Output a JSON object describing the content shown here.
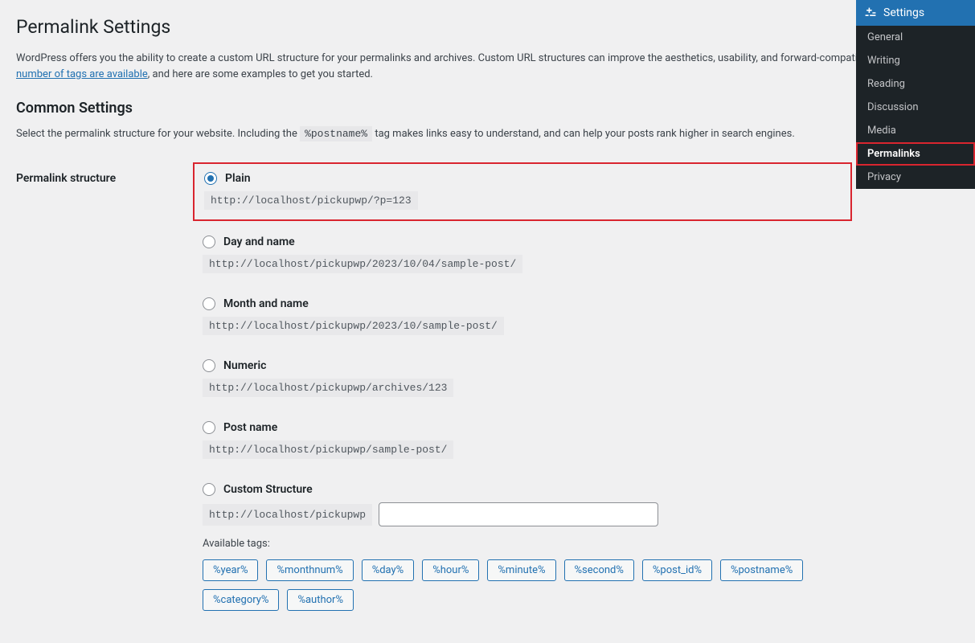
{
  "page": {
    "title": "Permalink Settings",
    "intro1": "WordPress offers you the ability to create a custom URL structure for your permalinks and archives. Custom URL structures can improve the aesthetics, usability, and forward-compatib",
    "intro_link": "number of tags are available",
    "intro_after": ", and here are some examples to get you started.",
    "section_title": "Common Settings",
    "section_desc_before": "Select the permalink structure for your website. Including the ",
    "section_tag": "%postname%",
    "section_desc_after": " tag makes links easy to understand, and can help your posts rank higher in search engines.",
    "structure_label": "Permalink structure"
  },
  "options": [
    {
      "label": "Plain",
      "url": "http://localhost/pickupwp/?p=123",
      "checked": true,
      "highlight": true
    },
    {
      "label": "Day and name",
      "url": "http://localhost/pickupwp/2023/10/04/sample-post/",
      "checked": false,
      "highlight": false
    },
    {
      "label": "Month and name",
      "url": "http://localhost/pickupwp/2023/10/sample-post/",
      "checked": false,
      "highlight": false
    },
    {
      "label": "Numeric",
      "url": "http://localhost/pickupwp/archives/123",
      "checked": false,
      "highlight": false
    },
    {
      "label": "Post name",
      "url": "http://localhost/pickupwp/sample-post/",
      "checked": false,
      "highlight": false
    }
  ],
  "custom": {
    "label": "Custom Structure",
    "prefix": "http://localhost/pickupwp",
    "value": "",
    "available_label": "Available tags:"
  },
  "tags": [
    "%year%",
    "%monthnum%",
    "%day%",
    "%hour%",
    "%minute%",
    "%second%",
    "%post_id%",
    "%postname%",
    "%category%",
    "%author%"
  ],
  "sidebar": {
    "header": "Settings",
    "items": [
      "General",
      "Writing",
      "Reading",
      "Discussion",
      "Media",
      "Permalinks",
      "Privacy"
    ],
    "active_index": 5
  }
}
